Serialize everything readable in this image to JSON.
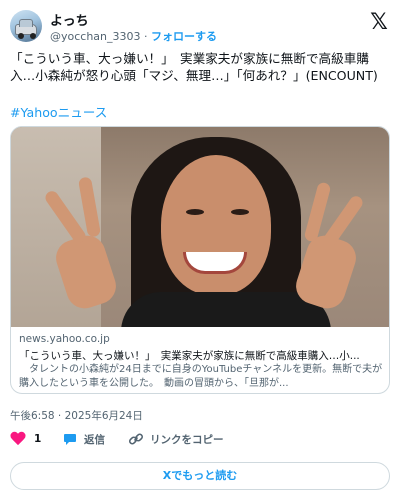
{
  "user": {
    "display_name": "よっち",
    "handle": "@yocchan_3303",
    "separator": "·",
    "follow_label": "フォローする"
  },
  "tweet": {
    "text": "「こういう車、大っ嫌い！」　実業家夫が家族に無断で高級車購入…小森純が怒り心頭「マジ、無理…」「何あれ？」(ENCOUNT)",
    "hashtag": "#Yahooニュース"
  },
  "card": {
    "domain": "news.yahoo.co.jp",
    "title": "「こういう車、大っ嫌い！」　実業家夫が家族に無断で高級車購入…小...",
    "description": "　タレントの小森純が24日までに自身のYouTubeチャンネルを更新。無断で夫が購入したという車を公開した。　動画の冒頭から、「旦那が..."
  },
  "timestamp": "午後6:58 · 2025年6月24日",
  "actions": {
    "like_count": "1",
    "reply_label": "返信",
    "copy_link_label": "リンクをコピー"
  },
  "read_more_label": "Xでもっと読む",
  "colors": {
    "accent": "#1d9bf0",
    "like": "#f91880",
    "text": "#0f1419",
    "secondary": "#536471",
    "border": "#cfd9de"
  }
}
